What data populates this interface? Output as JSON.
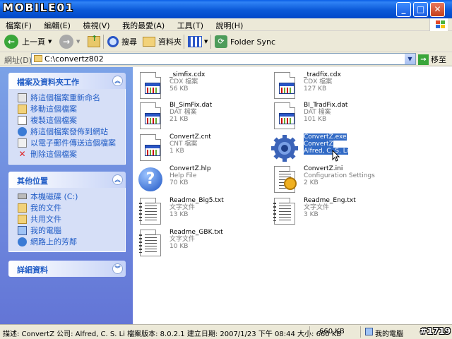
{
  "window": {
    "logo": "MOBILE01",
    "controls": {
      "minimize": "_",
      "maximize": "□",
      "close": "✕"
    }
  },
  "menu": [
    "檔案(F)",
    "編輯(E)",
    "檢視(V)",
    "我的最愛(A)",
    "工具(T)",
    "說明(H)"
  ],
  "toolbar": {
    "back_label": "上一頁",
    "search_label": "搜尋",
    "folders_label": "資料夾",
    "folder_sync_label": "Folder Sync"
  },
  "address": {
    "label": "網址(D)",
    "value": "C:\\convertz802",
    "go_label": "移至"
  },
  "panels": {
    "tasks": {
      "title": "檔案及資料夾工作",
      "items": [
        "將這個檔案重新命名",
        "移動這個檔案",
        "複製這個檔案",
        "將這個檔案發佈到網站",
        "以電子郵件傳送這個檔案",
        "刪除這個檔案"
      ]
    },
    "places": {
      "title": "其他位置",
      "items": [
        "本機磁碟 (C:)",
        "我的文件",
        "共用文件",
        "我的電腦",
        "網路上的芳鄰"
      ]
    },
    "details": {
      "title": "詳細資料"
    }
  },
  "files": [
    {
      "name": "_simfix.cdx",
      "type": "CDX 檔案",
      "size": "56 KB",
      "icon": "db-file-icon"
    },
    {
      "name": "_tradfix.cdx",
      "type": "CDX 檔案",
      "size": "127 KB",
      "icon": "db-file-icon"
    },
    {
      "name": "BI_SimFix.dat",
      "type": "DAT 檔案",
      "size": "21 KB",
      "icon": "db-file-icon"
    },
    {
      "name": "BI_TradFix.dat",
      "type": "DAT 檔案",
      "size": "101 KB",
      "icon": "db-file-icon"
    },
    {
      "name": "ConvertZ.cnt",
      "type": "CNT 檔案",
      "size": "1 KB",
      "icon": "db-file-icon"
    },
    {
      "name": "ConvertZ.exe",
      "type": "ConvertZ",
      "size": "Alfred, C. S. Li",
      "icon": "gear-icon",
      "selected": true
    },
    {
      "name": "ConvertZ.hlp",
      "type": "Help File",
      "size": "70 KB",
      "icon": "help-icon"
    },
    {
      "name": "ConvertZ.ini",
      "type": "Configuration Settings",
      "size": "2 KB",
      "icon": "settings-file-icon"
    },
    {
      "name": "Readme_Big5.txt",
      "type": "文字文件",
      "size": "13 KB",
      "icon": "notepad-icon"
    },
    {
      "name": "Readme_Eng.txt",
      "type": "文字文件",
      "size": "3 KB",
      "icon": "notepad-icon"
    },
    {
      "name": "Readme_GBK.txt",
      "type": "文字文件",
      "size": "10 KB",
      "icon": "notepad-icon"
    }
  ],
  "status": {
    "description": "描述: ConvertZ 公司: Alfred, C. S. Li 檔案版本: 8.0.2.1 建立日期: 2007/1/23 下午 08:44 大小: 660 KB",
    "size": "660 KB",
    "location": "我的電腦"
  },
  "watermark": "#1719",
  "colors": {
    "titlebar": "#0b59d8",
    "panel_header_text": "#215dc6",
    "selection": "#316ac5",
    "sidebar": "#7ba2e7"
  }
}
